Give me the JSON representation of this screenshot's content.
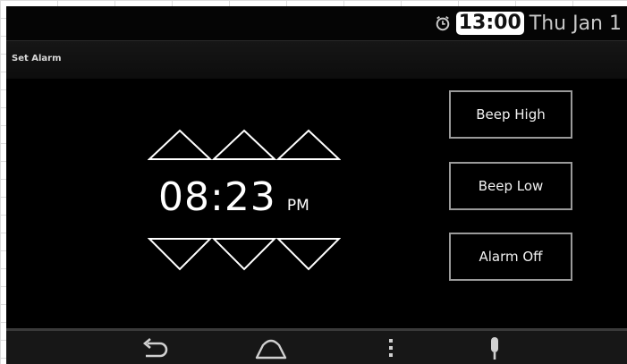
{
  "status_bar": {
    "time": "13:00",
    "date": "Thu Jan 1"
  },
  "action_bar": {
    "title": "Set Alarm"
  },
  "alarm": {
    "time": "08:23",
    "period": "PM"
  },
  "buttons": {
    "beep_high": "Beep High",
    "beep_low": "Beep Low",
    "alarm_off": "Alarm Off"
  },
  "nav": {
    "icons": [
      "back-icon",
      "home-icon",
      "menu-icon",
      "microphone-icon"
    ]
  },
  "colors": {
    "background": "#000000",
    "text": "#ffffff",
    "button_border": "#9a9a9a"
  }
}
